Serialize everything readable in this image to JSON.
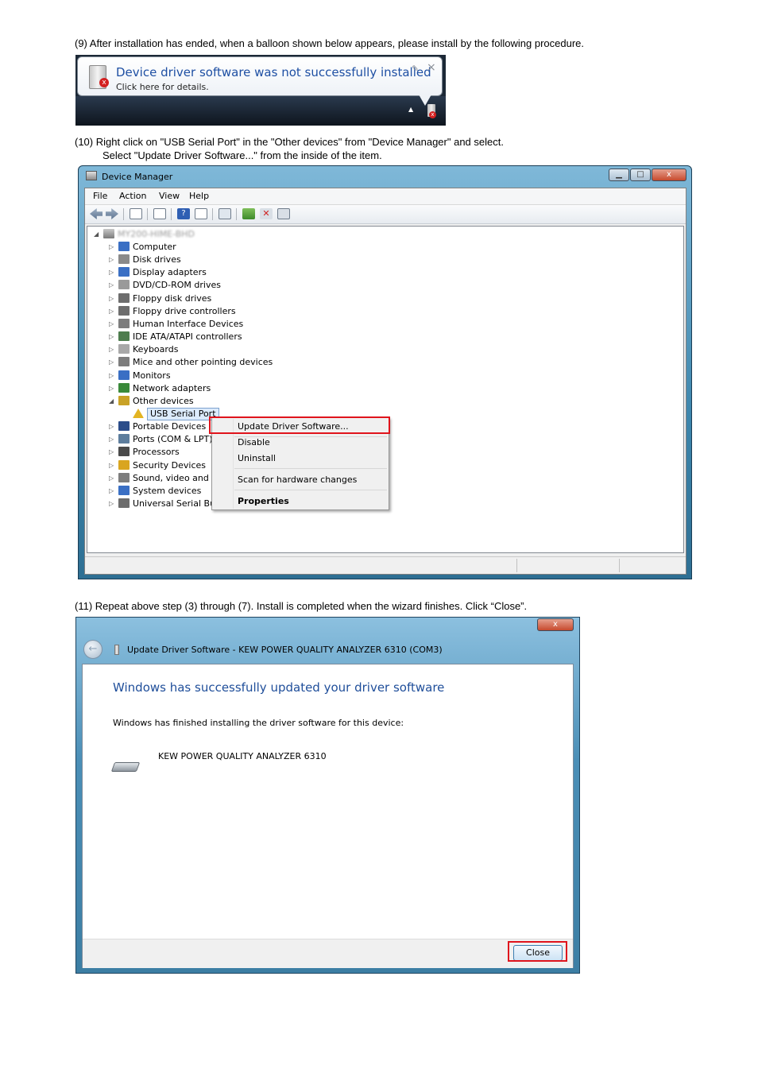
{
  "steps": {
    "step9": "(9)  After installation has ended, when a balloon shown below appears, please install by the following procedure.",
    "step10_line1": "(10)  Right click on \"USB Serial Port\" in the \"Other devices\" from \"Device Manager\" and select.",
    "step10_line2": "Select \"Update Driver Software...\" from the inside of the item.",
    "step11": "(11)  Repeat above step (3) through (7). Install is completed when the wizard finishes. Click “Close”."
  },
  "balloon": {
    "title": "Device driver software was not successfully installed",
    "subtitle": "Click here for details.",
    "pin_glyph": "✎",
    "close_glyph": "×",
    "tray_arrow": "▲",
    "error_badge": "x"
  },
  "device_manager": {
    "title": "Device Manager",
    "caption_buttons": {
      "minimize": "▁",
      "maximize": "□",
      "close": "x"
    },
    "menu": [
      "File",
      "Action",
      "View",
      "Help"
    ],
    "toolbar_icons": [
      "back-arrow-icon",
      "forward-arrow-icon",
      "console-tree-icon",
      "properties-icon",
      "help-icon",
      "view-icon",
      "scan-hardware-icon",
      "update-driver-icon",
      "uninstall-icon",
      "disable-icon"
    ],
    "tree": {
      "root_label": "MY200-HIME-BHD",
      "root_expander": "◢",
      "collapsed_glyph": "▷",
      "expanded_glyph": "◢",
      "categories": [
        {
          "label": "Computer",
          "icon": "computer-icon",
          "color": "#3a6fc4"
        },
        {
          "label": "Disk drives",
          "icon": "disk-drive-icon",
          "color": "#8a8a8a"
        },
        {
          "label": "Display adapters",
          "icon": "display-adapter-icon",
          "color": "#3a6fc4"
        },
        {
          "label": "DVD/CD-ROM drives",
          "icon": "dvd-drive-icon",
          "color": "#9a9a9a"
        },
        {
          "label": "Floppy disk drives",
          "icon": "floppy-drive-icon",
          "color": "#6d6d6d"
        },
        {
          "label": "Floppy drive controllers",
          "icon": "floppy-controller-icon",
          "color": "#6d6d6d"
        },
        {
          "label": "Human Interface Devices",
          "icon": "hid-icon",
          "color": "#7d7d7d"
        },
        {
          "label": "IDE ATA/ATAPI controllers",
          "icon": "ide-controller-icon",
          "color": "#4e7d4e"
        },
        {
          "label": "Keyboards",
          "icon": "keyboard-icon",
          "color": "#a8a8a8"
        },
        {
          "label": "Mice and other pointing devices",
          "icon": "mouse-icon",
          "color": "#7d7d7d"
        },
        {
          "label": "Monitors",
          "icon": "monitor-icon",
          "color": "#3a6fc4"
        },
        {
          "label": "Network adapters",
          "icon": "network-adapter-icon",
          "color": "#3a8a3a"
        },
        {
          "label": "Other devices",
          "icon": "other-devices-icon",
          "color": "#c9a227",
          "expanded": true
        },
        {
          "label": "USB Serial Port",
          "icon": "unknown-device-warning-icon",
          "color": "#e3b422",
          "child": true,
          "selected": true
        },
        {
          "label": "Portable Devices",
          "icon": "portable-device-icon",
          "color": "#2b4d8a"
        },
        {
          "label": "Ports (COM & LPT)",
          "icon": "ports-icon",
          "color": "#5d7d9d"
        },
        {
          "label": "Processors",
          "icon": "processor-icon",
          "color": "#4a4a4a"
        },
        {
          "label": "Security Devices",
          "icon": "security-device-icon",
          "color": "#d9a520"
        },
        {
          "label": "Sound, video and game controllers",
          "icon": "sound-icon",
          "color": "#7d7d7d"
        },
        {
          "label": "System devices",
          "icon": "system-devices-icon",
          "color": "#3a6fc4"
        },
        {
          "label": "Universal Serial Bus controllers",
          "icon": "usb-controller-icon",
          "color": "#6d6d6d"
        }
      ]
    },
    "context_menu": {
      "items": [
        "Update Driver Software...",
        "Disable",
        "Uninstall",
        "Scan for hardware changes",
        "Properties"
      ],
      "highlight_color": "#e0141c"
    }
  },
  "wizard": {
    "title": "Update Driver Software - KEW POWER QUALITY ANALYZER 6310 (COM3)",
    "back_glyph": "←",
    "close_glyph": "x",
    "heading": "Windows has successfully updated your driver software",
    "body": "Windows has finished installing the driver software for this device:",
    "device_name": "KEW POWER QUALITY ANALYZER 6310",
    "close_button": "Close",
    "highlight_color": "#e0141c"
  }
}
